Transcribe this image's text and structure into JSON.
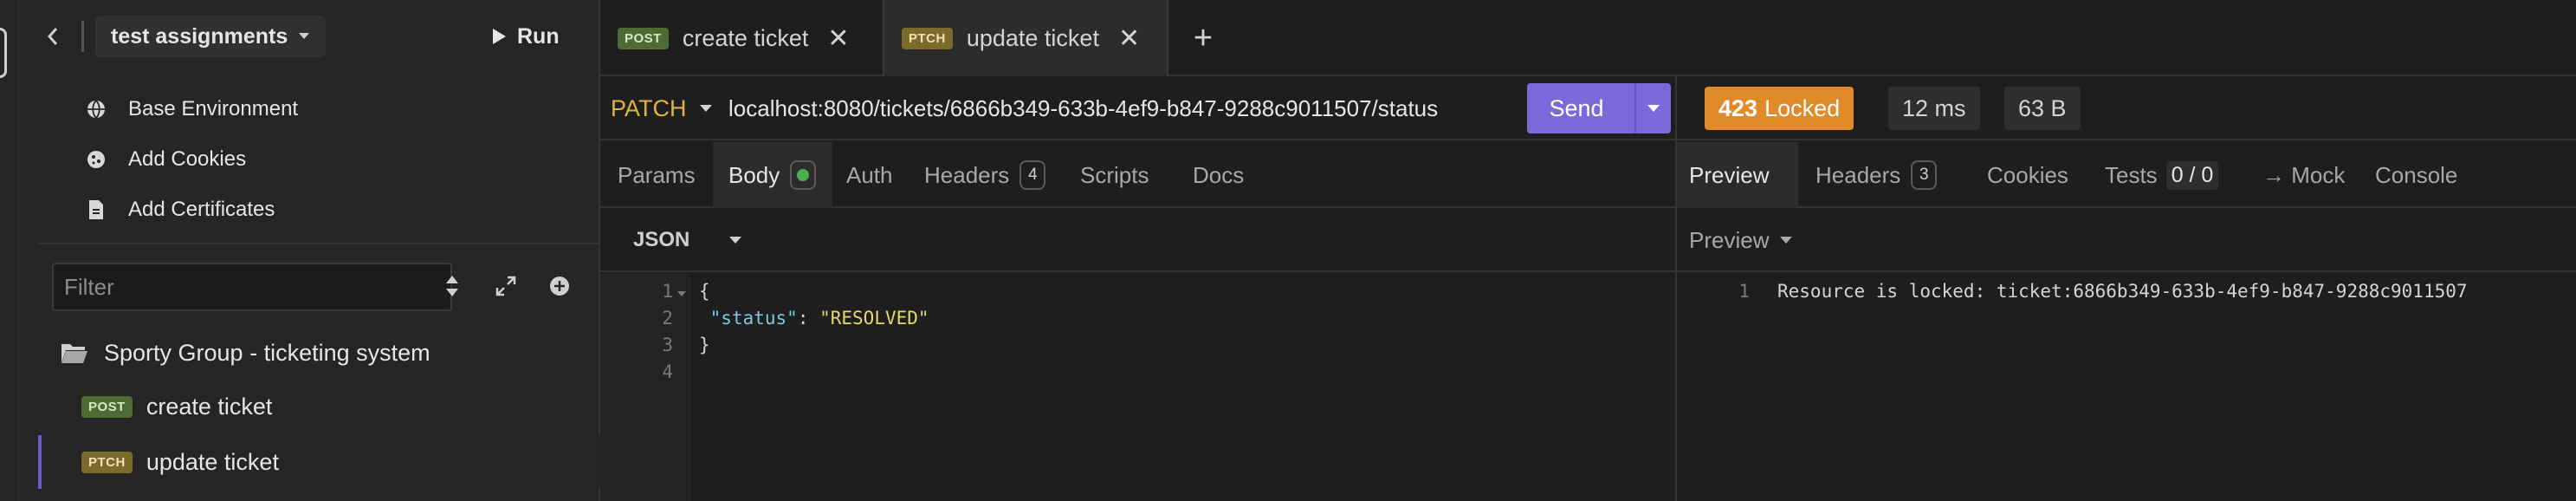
{
  "sidebar": {
    "workspace_name": "test assignments",
    "run_label": "Run",
    "env_items": [
      {
        "label": "Base Environment",
        "icon": "globe-icon"
      },
      {
        "label": "Add Cookies",
        "icon": "cookie-icon"
      },
      {
        "label": "Add Certificates",
        "icon": "certificate-icon"
      }
    ],
    "filter_placeholder": "Filter",
    "collection_name": "Sporty Group - ticketing system",
    "requests": [
      {
        "method": "POST",
        "name": "create ticket"
      },
      {
        "method": "PTCH",
        "name": "update ticket",
        "active": true
      }
    ]
  },
  "tabs": [
    {
      "method": "POST",
      "label": "create ticket"
    },
    {
      "method": "PTCH",
      "label": "update ticket",
      "active": true
    }
  ],
  "request": {
    "method": "PATCH",
    "url": "localhost:8080/tickets/6866b349-633b-4ef9-b847-9288c9011507/status",
    "send_label": "Send",
    "subtabs": {
      "params": "Params",
      "body": "Body",
      "auth": "Auth",
      "headers": "Headers",
      "headers_count": "4",
      "scripts": "Scripts",
      "docs": "Docs"
    },
    "body_type": "JSON",
    "body_lines": [
      "1",
      "2",
      "3",
      "4"
    ],
    "body_code": {
      "open": "{",
      "key": "\"status\"",
      "colon": ": ",
      "value": "\"RESOLVED\"",
      "close": "}"
    }
  },
  "response": {
    "status_code": "423",
    "status_text": "Locked",
    "time": "12 ms",
    "size": "63 B",
    "tabs": {
      "preview": "Preview",
      "headers": "Headers",
      "headers_count": "3",
      "cookies": "Cookies",
      "tests": "Tests",
      "tests_score": "0 / 0",
      "mock": "→ Mock",
      "console": "Console"
    },
    "preview_mode": "Preview",
    "line_number": "1",
    "body_text": "Resource is locked: ticket:6866b349-633b-4ef9-b847-9288c9011507"
  },
  "colors": {
    "accent": "#7b68d9",
    "status_locked": "#e18a2a",
    "method_patch": "#e0b43c",
    "badge_post": "#4e6b34",
    "badge_ptch": "#7a6a2c",
    "json_key": "#7ec8e3",
    "json_string": "#e5d96a"
  }
}
